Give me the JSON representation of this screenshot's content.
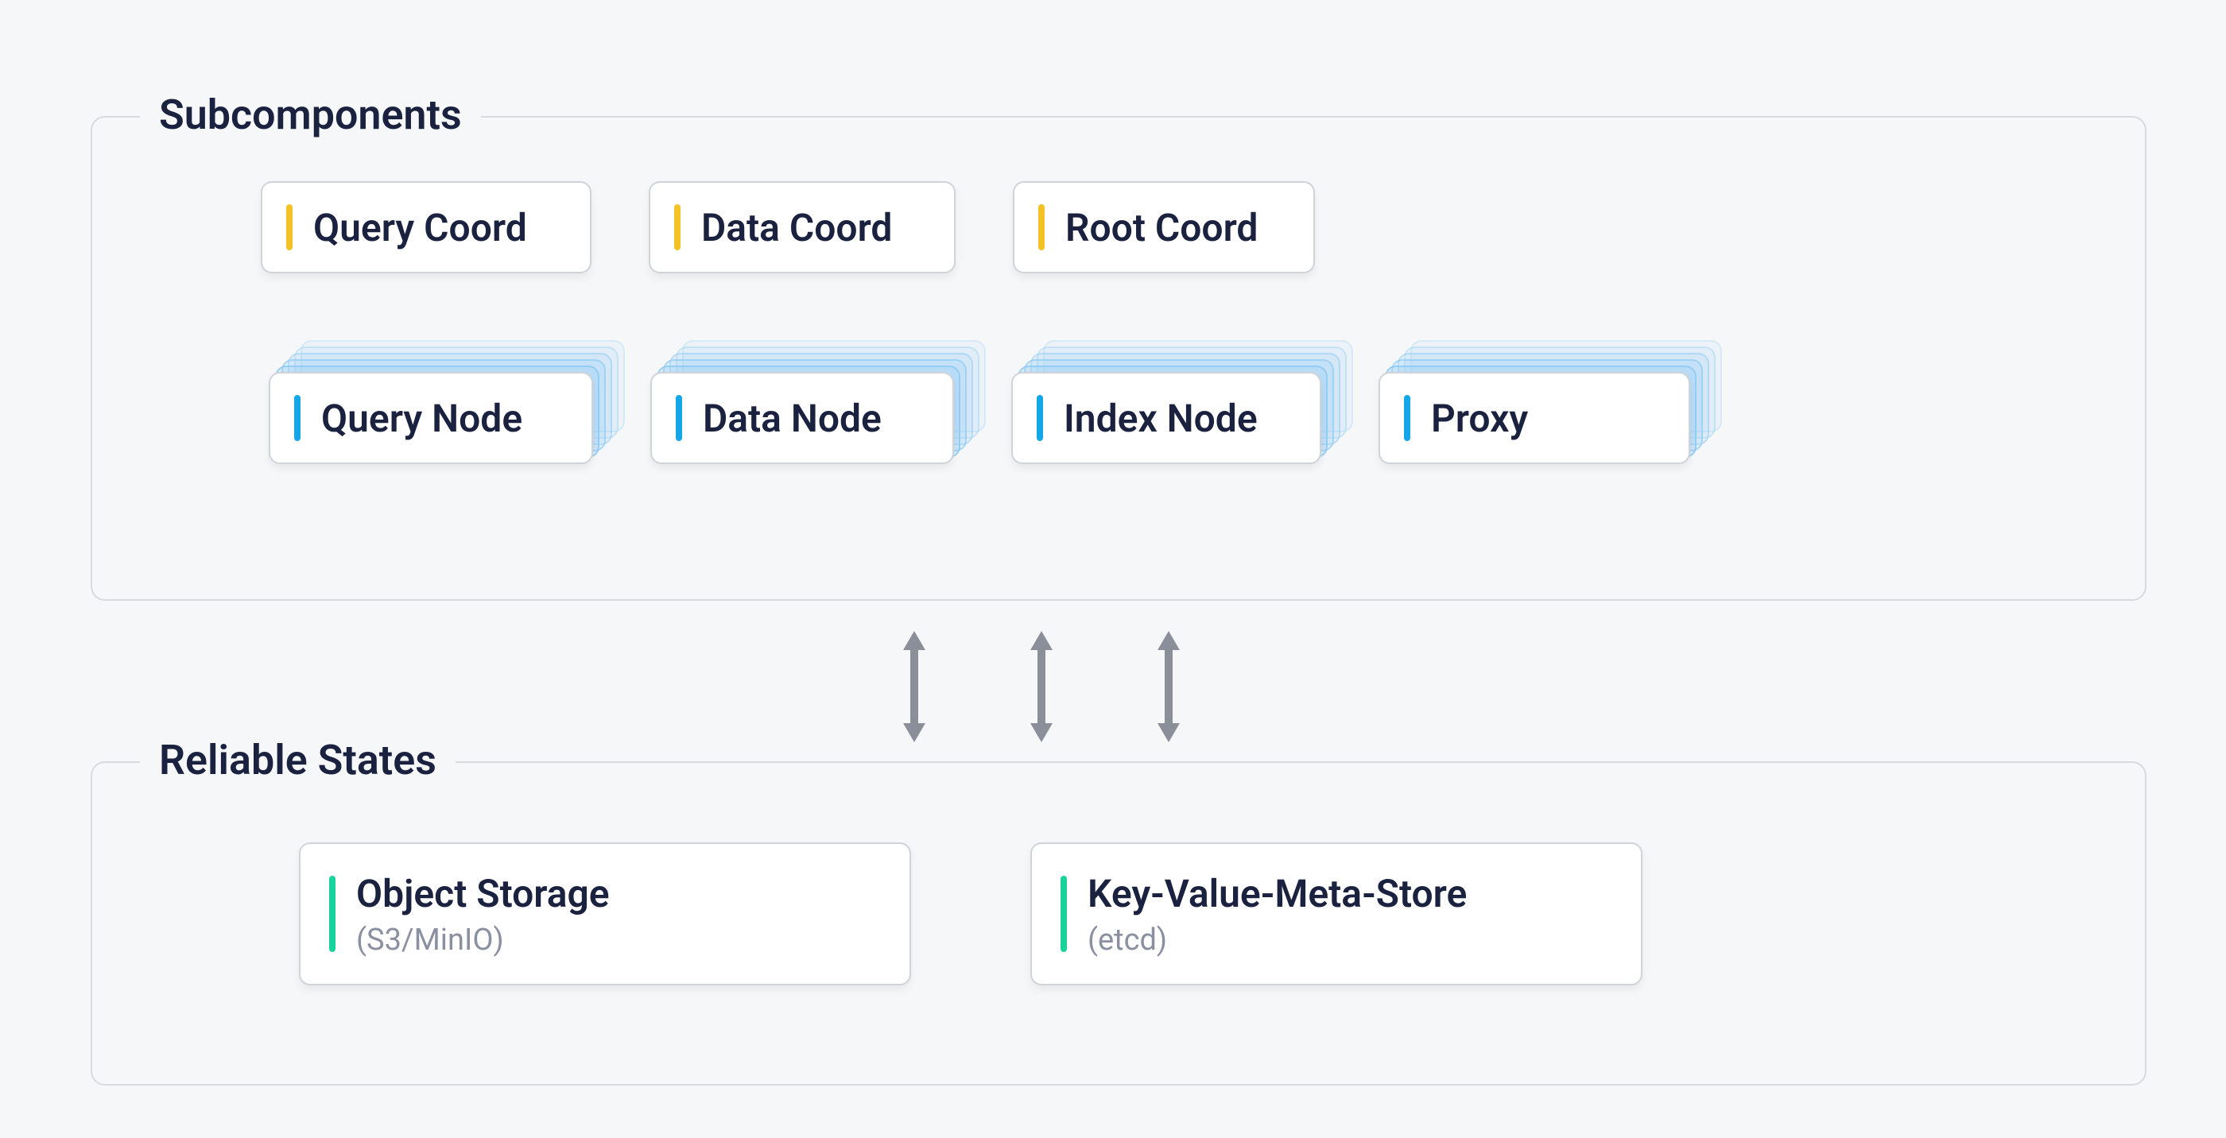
{
  "groups": {
    "subcomponents": {
      "title": "Subcomponents"
    },
    "reliable_states": {
      "title": "Reliable States"
    }
  },
  "coords": [
    {
      "label": "Query Coord"
    },
    {
      "label": "Data Coord"
    },
    {
      "label": "Root Coord"
    }
  ],
  "nodes": [
    {
      "label": "Query Node"
    },
    {
      "label": "Data Node"
    },
    {
      "label": "Index Node"
    },
    {
      "label": "Proxy"
    }
  ],
  "stores": [
    {
      "label": "Object Storage",
      "sublabel": "(S3/MinIO)"
    },
    {
      "label": "Key-Value-Meta-Store",
      "sublabel": "(etcd)"
    }
  ],
  "colors": {
    "coord_bar": "#f4c224",
    "node_bar": "#13a7e8",
    "store_bar": "#19d39d",
    "text": "#1a2240",
    "subtext": "#8b90a0",
    "border": "#d8dadd",
    "bg": "#f6f7f8"
  }
}
